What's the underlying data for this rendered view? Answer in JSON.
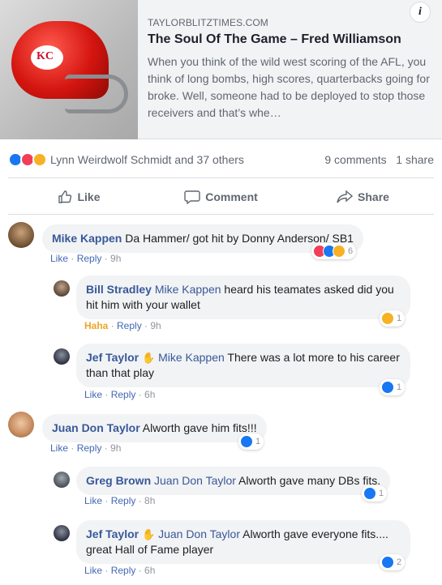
{
  "preview": {
    "domain": "TAYLORBLITZTIMES.COM",
    "title": "The Soul Of The Game – Fred Williamson",
    "description": "When you think of the wild west scoring of the AFL, you think of long bombs, high scores, quarterbacks going for broke. Well, someone had to be deployed to stop those receivers and that’s whe…",
    "info_icon": "i"
  },
  "summary": {
    "reactors": "Lynn Weirdwolf Schmidt and 37 others",
    "comments": "9 comments",
    "shares": "1 share",
    "icons": [
      "like-icon",
      "love-icon",
      "haha-icon"
    ]
  },
  "actions": {
    "like": "Like",
    "comment": "Comment",
    "share": "Share"
  },
  "colors": {
    "like": "#1877f2",
    "love": "#f33e58",
    "haha": "#f7b125",
    "link": "#385898",
    "meta_link": "#4267b2"
  },
  "comments": [
    {
      "author": "Mike Kappen",
      "text": " Da Hammer/ got hit by Donny Anderson/ SB1",
      "meta": {
        "like": "Like",
        "reply": "Reply",
        "time": "9h"
      },
      "reaction_count": "6",
      "reactions": [
        "love-icon",
        "like-icon",
        "haha-icon"
      ]
    },
    {
      "author": "Bill Stradley",
      "mention": "Mike Kappen",
      "text": " heard his teamates asked did you hit him with your wallet",
      "meta": {
        "like": "Haha",
        "reply": "Reply",
        "time": "9h"
      },
      "reaction_count": "1",
      "reactions": [
        "haha-icon"
      ]
    },
    {
      "author": "Jef Taylor",
      "mention": "Mike Kappen",
      "text": " There was a lot more to his career than that play",
      "meta": {
        "like": "Like",
        "reply": "Reply",
        "time": "6h"
      },
      "reaction_count": "1",
      "reactions": [
        "like-icon"
      ]
    },
    {
      "author": "Juan Don Taylor",
      "text": " Alworth gave him fits!!!",
      "meta": {
        "like": "Like",
        "reply": "Reply",
        "time": "9h"
      },
      "reaction_count": "1",
      "reactions": [
        "like-icon"
      ]
    },
    {
      "author": "Greg Brown",
      "mention": "Juan Don Taylor",
      "text": " Alworth gave many DBs fits.",
      "meta": {
        "like": "Like",
        "reply": "Reply",
        "time": "8h"
      },
      "reaction_count": "1",
      "reactions": [
        "like-icon"
      ]
    },
    {
      "author": "Jef Taylor",
      "mention": "Juan Don Taylor",
      "text": " Alworth gave everyone fits.... great Hall of Fame player",
      "meta": {
        "like": "Like",
        "reply": "Reply",
        "time": "6h"
      },
      "reaction_count": "2",
      "reactions": [
        "like-icon"
      ]
    }
  ],
  "sep": " · "
}
